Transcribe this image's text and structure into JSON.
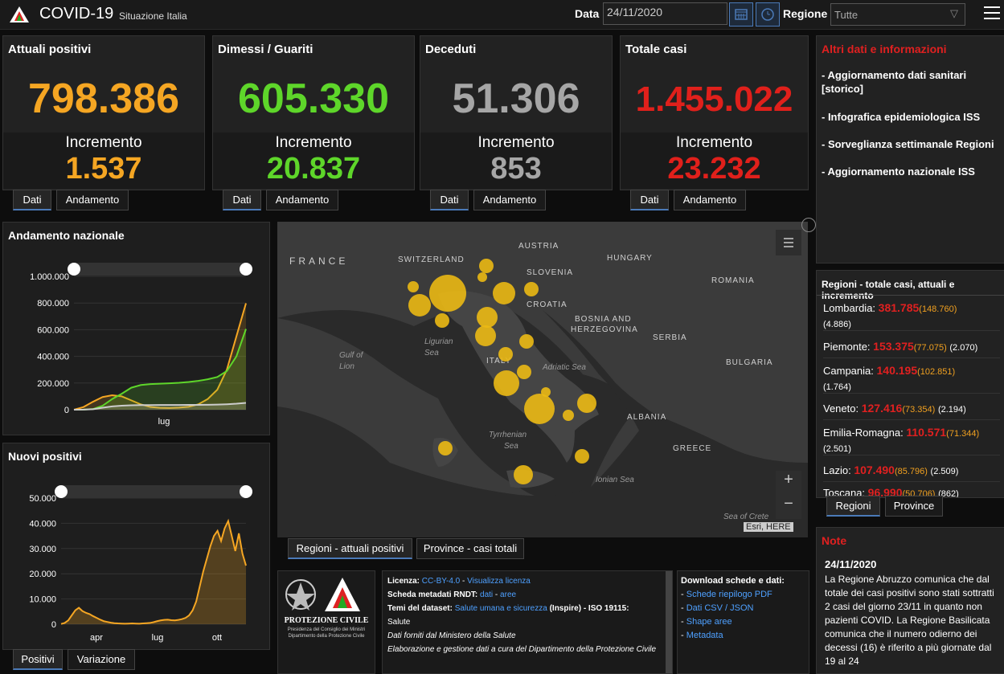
{
  "header": {
    "title": "COVID-19",
    "subtitle": "Situazione Italia",
    "date_label": "Data",
    "date_value": "24/11/2020",
    "region_label": "Regione",
    "region_value": "Tutte"
  },
  "cards": [
    {
      "title": "Attuali positivi",
      "value": "798.386",
      "incr_label": "Incremento",
      "incr": "1.537",
      "color": "#f5a623",
      "tab1": "Dati",
      "tab2": "Andamento"
    },
    {
      "title": "Dimessi / Guariti",
      "value": "605.330",
      "incr_label": "Incremento",
      "incr": "20.837",
      "color": "#5ed62a",
      "tab1": "Dati",
      "tab2": "Andamento"
    },
    {
      "title": "Deceduti",
      "value": "51.306",
      "incr_label": "Incremento",
      "incr": "853",
      "color": "#a6a6a6",
      "tab1": "Dati",
      "tab2": "Andamento"
    },
    {
      "title": "Totale casi",
      "value": "1.455.022",
      "incr_label": "Incremento",
      "incr": "23.232",
      "color": "#e0201b",
      "tab1": "Dati",
      "tab2": "Andamento"
    }
  ],
  "info": {
    "title": "Altri dati e informazioni",
    "links": [
      "- Aggiornamento dati sanitari [storico]",
      "- Infografica epidemiologica ISS",
      "- Sorveglianza settimanale Regioni",
      "- Aggiornamento nazionale ISS"
    ]
  },
  "regions": {
    "title": "Regioni - totale casi, attuali e incremento",
    "rows": [
      {
        "name": "Lombardia:",
        "total": "381.785",
        "active": "(148.760)",
        "inc": "(4.886)"
      },
      {
        "name": "Piemonte:",
        "total": "153.375",
        "active": "(77.075)",
        "inc": "(2.070)"
      },
      {
        "name": "Campania:",
        "total": "140.195",
        "active": "(102.851)",
        "inc": "(1.764)"
      },
      {
        "name": "Veneto:",
        "total": "127.416",
        "active": "(73.354)",
        "inc": "(2.194)"
      },
      {
        "name": "Emilia-Romagna:",
        "total": "110.571",
        "active": "(71.344)",
        "inc": "(2.501)"
      },
      {
        "name": "Lazio:",
        "total": "107.490",
        "active": "(85.796)",
        "inc": "(2.509)"
      },
      {
        "name": "Toscana:",
        "total": "96.990",
        "active": "(50.706)",
        "inc": "(862)"
      }
    ],
    "tab1": "Regioni",
    "tab2": "Province"
  },
  "notes": {
    "title": "Note",
    "date": "24/11/2020",
    "text": "La Regione Abruzzo comunica che dal totale dei casi positivi sono stati sottratti 2 casi del giorno 23/11 in quanto non pazienti COVID. La Regione Basilicata comunica che il numero odierno dei decessi (16) è riferito a più giornate dal 19 al 24"
  },
  "map": {
    "labels": [
      "FRANCE",
      "SWITZERLAND",
      "AUSTRIA",
      "SLOVENIA",
      "HUNGARY",
      "ROMANIA",
      "CROATIA",
      "BOSNIA AND",
      "HERZEGOVINA",
      "SERBIA",
      "BULGARIA",
      "ITALY",
      "ALBANIA",
      "GREECE"
    ],
    "seas": [
      "Gulf of",
      "Lion",
      "Ligurian",
      "Sea",
      "Adriatic Sea",
      "Tyrrhenian",
      "Sea",
      "Ionian Sea",
      "Sea of Crete"
    ],
    "attribution": "Esri, HERE",
    "tab1": "Regioni - attuali positivi",
    "tab2": "Province - casi totali",
    "zoom_in": "+",
    "zoom_out": "−"
  },
  "footer": {
    "logo_text": "PROTEZIONE CIVILE",
    "logo_sub1": "Presidenza del Consiglio dei Ministri",
    "logo_sub2": "Dipartimento della Protezione Civile",
    "licenza_label": "Licenza:",
    "licenza_value": "CC-BY-4.0",
    "licenza_link": "Visualizza licenza",
    "metadati_label": "Scheda metadati RNDT:",
    "metadati_link1": "dati",
    "metadati_link2": "aree",
    "temi_label": "Temi del dataset:",
    "temi_link": "Salute umana e sicurezza",
    "temi_rest": "(Inspire) - ISO 19115:",
    "temi_rest2": "Salute",
    "source1": "Dati forniti dal Ministero della Salute",
    "source2": "Elaborazione e gestione dati a cura del Dipartimento della Protezione Civile",
    "download_title": "Download schede e dati:",
    "dl1": "Schede riepilogo PDF",
    "dl2": "Dati CSV / JSON",
    "dl3": "Shape aree",
    "dl4": "Metadata"
  },
  "chart_data": [
    {
      "type": "area",
      "title": "Andamento nazionale",
      "yticks": [
        "1.000.000",
        "800.000",
        "600.000",
        "400.000",
        "200.000",
        "0"
      ],
      "xticks": [
        "lug"
      ],
      "ylim": [
        0,
        1000000
      ],
      "series": [
        {
          "color": "#f5a623",
          "values": [
            0,
            20000,
            60000,
            95000,
            108000,
            100000,
            70000,
            40000,
            20000,
            14000,
            13000,
            16000,
            22000,
            40000,
            80000,
            150000,
            300000,
            550000,
            798386
          ]
        },
        {
          "color": "#5ed62a",
          "values": [
            0,
            1000,
            5000,
            30000,
            80000,
            120000,
            165000,
            185000,
            192000,
            195000,
            198000,
            202000,
            208000,
            216000,
            228000,
            245000,
            290000,
            400000,
            605330
          ]
        },
        {
          "color": "#cccccc",
          "values": [
            0,
            500,
            4000,
            15000,
            25000,
            30000,
            33000,
            34500,
            35000,
            35300,
            35500,
            35700,
            35900,
            36200,
            37000,
            38500,
            41000,
            45000,
            51306
          ]
        }
      ],
      "tab1": "",
      "tab2": ""
    },
    {
      "type": "bar",
      "title": "Nuovi positivi",
      "yticks": [
        "50.000",
        "40.000",
        "30.000",
        "20.000",
        "10.000",
        "0"
      ],
      "xticks": [
        "apr",
        "lug",
        "ott"
      ],
      "ylim": [
        0,
        50000
      ],
      "values": [
        100,
        500,
        1500,
        3500,
        5500,
        6500,
        5200,
        4500,
        4000,
        3200,
        2500,
        1800,
        1200,
        900,
        600,
        400,
        300,
        250,
        200,
        250,
        300,
        250,
        200,
        300,
        400,
        500,
        800,
        1200,
        1500,
        1700,
        1800,
        1600,
        1500,
        1700,
        2000,
        2500,
        3500,
        5500,
        9000,
        15000,
        21000,
        26000,
        31000,
        35000,
        37000,
        33000,
        38000,
        40902,
        35000,
        29000,
        36000,
        28000,
        23232
      ],
      "tab1": "Positivi",
      "tab2": "Variazione"
    }
  ]
}
